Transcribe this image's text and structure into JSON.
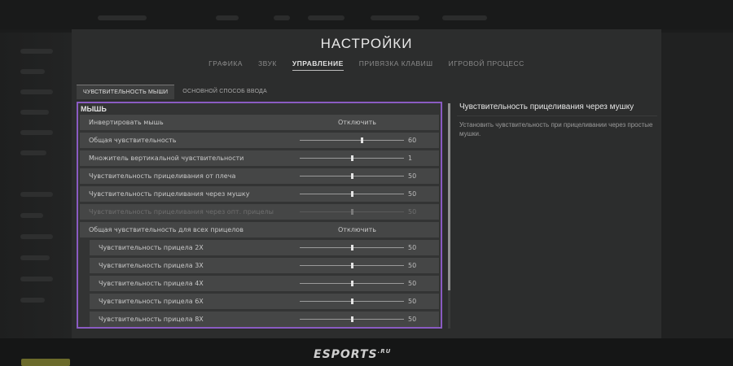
{
  "window_title": "НАСТРОЙКИ",
  "main_tabs": [
    {
      "label": "ГРАФИКА",
      "active": false
    },
    {
      "label": "ЗВУК",
      "active": false
    },
    {
      "label": "УПРАВЛЕНИЕ",
      "active": true
    },
    {
      "label": "ПРИВЯЗКА КЛАВИШ",
      "active": false
    },
    {
      "label": "ИГРОВОЙ ПРОЦЕСС",
      "active": false
    }
  ],
  "sub_tabs": [
    {
      "label": "ЧУВСТВИТЕЛЬНОСТЬ МЫШИ",
      "active": true
    },
    {
      "label": "ОСНОВНОЙ СПОСОБ ВВОДА",
      "active": false
    }
  ],
  "section": {
    "title": "МЫШЬ"
  },
  "rows": [
    {
      "label": "Инвертировать мышь",
      "kind": "toggle",
      "value": "Отключить"
    },
    {
      "label": "Общая чувствительность",
      "kind": "slider",
      "value": "60",
      "fraction": 0.6
    },
    {
      "label": "Множитель вертикальной чувствительности",
      "kind": "slider",
      "value": "1",
      "fraction": 0.5
    },
    {
      "label": "Чувствительность прицеливания от плеча",
      "kind": "slider",
      "value": "50",
      "fraction": 0.5
    },
    {
      "label": "Чувствительность прицеливания через мушку",
      "kind": "slider",
      "value": "50",
      "fraction": 0.5
    },
    {
      "label": "Чувствительность прицеливания через опт. прицелы",
      "kind": "slider",
      "value": "50",
      "fraction": 0.5,
      "disabled": true
    },
    {
      "label": "Общая чувствительность для всех прицелов",
      "kind": "toggle",
      "value": "Отключить"
    },
    {
      "label": "Чувствительность прицела 2X",
      "kind": "slider",
      "value": "50",
      "fraction": 0.5,
      "sub": true
    },
    {
      "label": "Чувствительность прицела 3X",
      "kind": "slider",
      "value": "50",
      "fraction": 0.5,
      "sub": true
    },
    {
      "label": "Чувствительность прицела 4X",
      "kind": "slider",
      "value": "50",
      "fraction": 0.5,
      "sub": true
    },
    {
      "label": "Чувствительность прицела 6X",
      "kind": "slider",
      "value": "50",
      "fraction": 0.5,
      "sub": true
    },
    {
      "label": "Чувствительность прицела 8X",
      "kind": "slider",
      "value": "50",
      "fraction": 0.5,
      "sub": true
    }
  ],
  "description": {
    "title": "Чувствительность прицеливания через мушку",
    "text": "Установить чувствительность при прицеливании через простые мушки."
  },
  "watermark": {
    "brand": "ESPORTS",
    "suffix": ".RU"
  },
  "colors": {
    "highlight_border": "#8a5bc2",
    "panel_bg": "#2c2d2d"
  }
}
